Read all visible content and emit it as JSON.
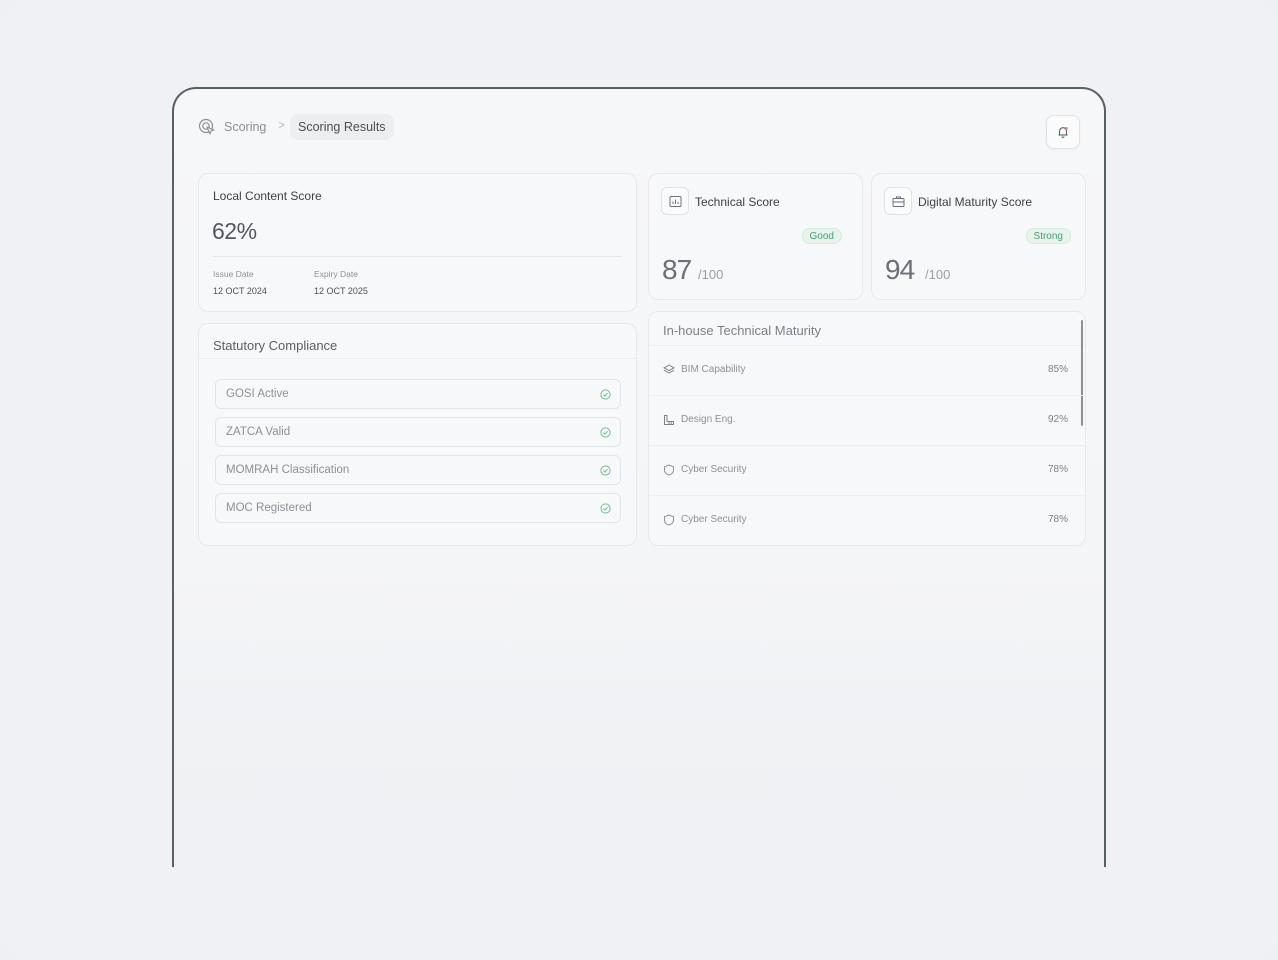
{
  "breadcrumb": {
    "parent": "Scoring",
    "separator": ">",
    "current": "Scoring Results"
  },
  "local_content": {
    "title": "Local Content Score",
    "value": "62%",
    "issue_label": "Issue Date",
    "issue_value": "12 OCT 2024",
    "expiry_label": "Expiry Date",
    "expiry_value": "12 OCT 2025"
  },
  "technical": {
    "title": "Technical Score",
    "badge": "Good",
    "value": "87",
    "suffix": "/100",
    "icon": "chart-icon"
  },
  "digital": {
    "title": "Digital Maturity Score",
    "badge": "Strong",
    "value": "94",
    "suffix": "/100",
    "icon": "briefcase-icon"
  },
  "statutory": {
    "title": "Statutory Compliance",
    "items": [
      {
        "label": "GOSI Active"
      },
      {
        "label": "ZATCA Valid"
      },
      {
        "label": "MOMRAH Classification"
      },
      {
        "label": "MOC Registered"
      }
    ]
  },
  "maturity": {
    "title": "In-house Technical Maturity",
    "items": [
      {
        "label": "BIM Capability",
        "value": "85%",
        "icon": "layers-icon"
      },
      {
        "label": "Design Eng.",
        "value": "92%",
        "icon": "blueprint-icon"
      },
      {
        "label": "Cyber Security",
        "value": "78%",
        "icon": "shield-icon"
      },
      {
        "label": "Cyber Security",
        "value": "78%",
        "icon": "shield-icon"
      }
    ]
  },
  "colors": {
    "frame_border": "#56625f",
    "badge_green": "#4e9b78",
    "check_green": "#6fbf94"
  }
}
